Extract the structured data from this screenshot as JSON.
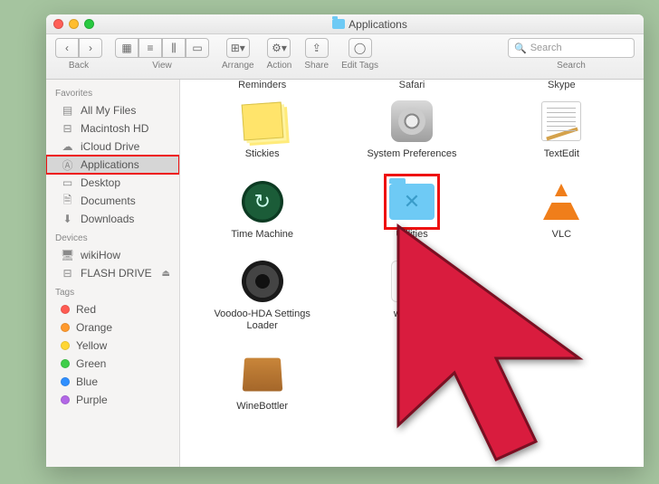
{
  "window": {
    "title": "Applications"
  },
  "toolbar": {
    "back_label": "Back",
    "view_label": "View",
    "arrange_label": "Arrange",
    "action_label": "Action",
    "share_label": "Share",
    "edit_tags_label": "Edit Tags",
    "search_label": "Search",
    "search_placeholder": "Search"
  },
  "sidebar": {
    "sections": [
      {
        "header": "Favorites",
        "items": [
          {
            "label": "All My Files",
            "icon": "all-files"
          },
          {
            "label": "Macintosh HD",
            "icon": "disk"
          },
          {
            "label": "iCloud Drive",
            "icon": "cloud"
          },
          {
            "label": "Applications",
            "icon": "apps",
            "selected": true,
            "highlighted": true
          },
          {
            "label": "Desktop",
            "icon": "desktop"
          },
          {
            "label": "Documents",
            "icon": "documents"
          },
          {
            "label": "Downloads",
            "icon": "downloads"
          }
        ]
      },
      {
        "header": "Devices",
        "items": [
          {
            "label": "wikiHow",
            "icon": "computer"
          },
          {
            "label": "FLASH DRIVE",
            "icon": "drive",
            "eject": true
          }
        ]
      },
      {
        "header": "Tags",
        "items": [
          {
            "label": "Red",
            "color": "#ff5b52"
          },
          {
            "label": "Orange",
            "color": "#ff9a2e"
          },
          {
            "label": "Yellow",
            "color": "#ffd633"
          },
          {
            "label": "Green",
            "color": "#3fce4a"
          },
          {
            "label": "Blue",
            "color": "#2f8fff"
          },
          {
            "label": "Purple",
            "color": "#b267e6"
          }
        ]
      }
    ]
  },
  "content": {
    "partial_row": [
      {
        "label": "Reminders"
      },
      {
        "label": "Safari"
      },
      {
        "label": "Skype"
      }
    ],
    "apps": [
      {
        "label": "Stickies",
        "icon": "stickies"
      },
      {
        "label": "System Preferences",
        "icon": "gear"
      },
      {
        "label": "TextEdit",
        "icon": "textedit"
      },
      {
        "label": "Time Machine",
        "icon": "tm"
      },
      {
        "label": "Utilities",
        "icon": "util",
        "highlighted": true
      },
      {
        "label": "VLC",
        "icon": "vlc"
      },
      {
        "label": "Voodoo-HDA Settings Loader",
        "icon": "speaker"
      },
      {
        "label": "wikiHow",
        "icon": "wh"
      },
      {
        "label": "",
        "icon": ""
      },
      {
        "label": "WineBottler",
        "icon": "box"
      }
    ]
  }
}
